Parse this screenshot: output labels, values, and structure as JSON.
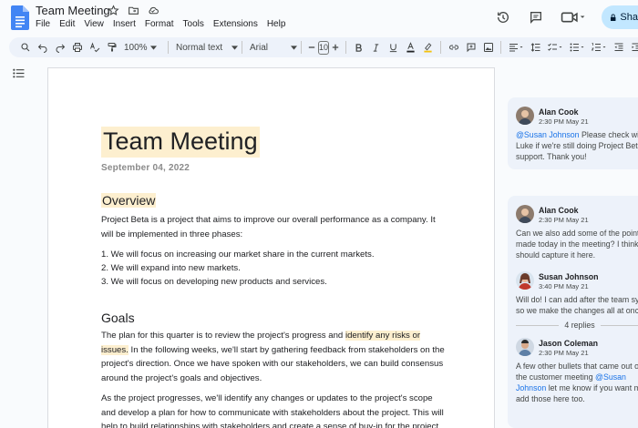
{
  "header": {
    "title": "Team Meeting",
    "menu": [
      "File",
      "Edit",
      "View",
      "Insert",
      "Format",
      "Tools",
      "Extensions",
      "Help"
    ],
    "share_label": "Sha"
  },
  "toolbar": {
    "zoom": "100%",
    "style": "Normal text",
    "font": "Arial",
    "font_size": "10"
  },
  "document": {
    "title": "Team Meeting",
    "date": "September 04, 2022",
    "overview_heading": "Overview",
    "overview_text": "Project Beta is a project that aims to improve our overall performance as a company. It will be implemented in three phases:",
    "phases": [
      "1.  We will focus on increasing our market share in the current markets.",
      "2.  We will expand into new markets.",
      "3.  We will focus on developing new products and services."
    ],
    "goals_heading": "Goals",
    "goals_p1_before": "The plan for this quarter is to review the project's progress and ",
    "goals_p1_highlight": "identify any risks or issues.",
    "goals_p1_after": " In the following weeks, we'll start by gathering feedback from stakeholders on the project's direction. Once we have spoken with our stakeholders, we can build consensus around the project's goals and objectives.",
    "goals_p2": "As the project progresses, we'll identify any changes or updates to the project's scope and develop a plan for how to communicate with stakeholders about the project. This will help to build relationships with stakeholders and create a sense of buy-in for the project."
  },
  "comments": {
    "thread1": {
      "name": "Alan Cook",
      "time": "2:30 PM May 21",
      "line1_mention": "@Susan Johnson",
      "line1_rest": " Please check with",
      "line2": "Luke if we're still doing Project Beta",
      "line3": "support. Thank you!"
    },
    "thread2": {
      "c1_name": "Alan Cook",
      "c1_time": "2:30 PM May 21",
      "c1_line1": "Can we also add some of the points",
      "c1_line2": "made today in the meeting? I think w",
      "c1_line3": "should capture it here.",
      "c2_name": "Susan Johnson",
      "c2_time": "3:40 PM May 21",
      "c2_line1": "Will do! I can add after the team sync",
      "c2_line2": "so we make the changes all at once",
      "replies": "4 replies",
      "c3_name": "Jason Coleman",
      "c3_time": "2:30 PM May 21",
      "c3_line1": "A few other bullets that came out of",
      "c3_line2_before": "the customer meeting ",
      "c3_line2_mention": "@Susan",
      "c3_line3_mention": "Johnson",
      "c3_line3_rest": " let me know if you want me to",
      "c3_line4": "add those here too."
    }
  },
  "colors": {
    "accent": "#1a73e8",
    "highlight": "#fdefcf",
    "share": "#c2e7ff",
    "toolbar": "#edf2fa"
  }
}
